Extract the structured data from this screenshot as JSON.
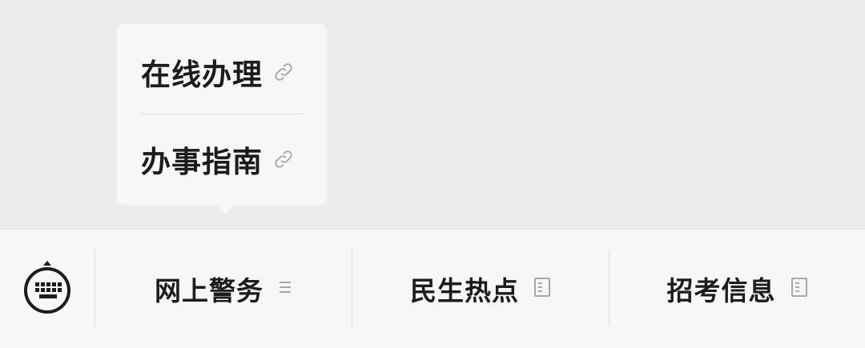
{
  "popup_menu": {
    "items": [
      {
        "label": "在线办理",
        "icon": "link-icon"
      },
      {
        "label": "办事指南",
        "icon": "link-icon"
      }
    ]
  },
  "bottom_bar": {
    "keyboard_icon": "keyboard-icon",
    "tabs": [
      {
        "label": "网上警务",
        "icon": "menu-lines-icon"
      },
      {
        "label": "民生热点",
        "icon": "document-icon"
      },
      {
        "label": "招考信息",
        "icon": "document-icon"
      }
    ]
  },
  "colors": {
    "background": "#ececec",
    "surface": "#f7f7f7",
    "text": "#1c1c1c",
    "icon_muted": "#a8a8a8"
  }
}
